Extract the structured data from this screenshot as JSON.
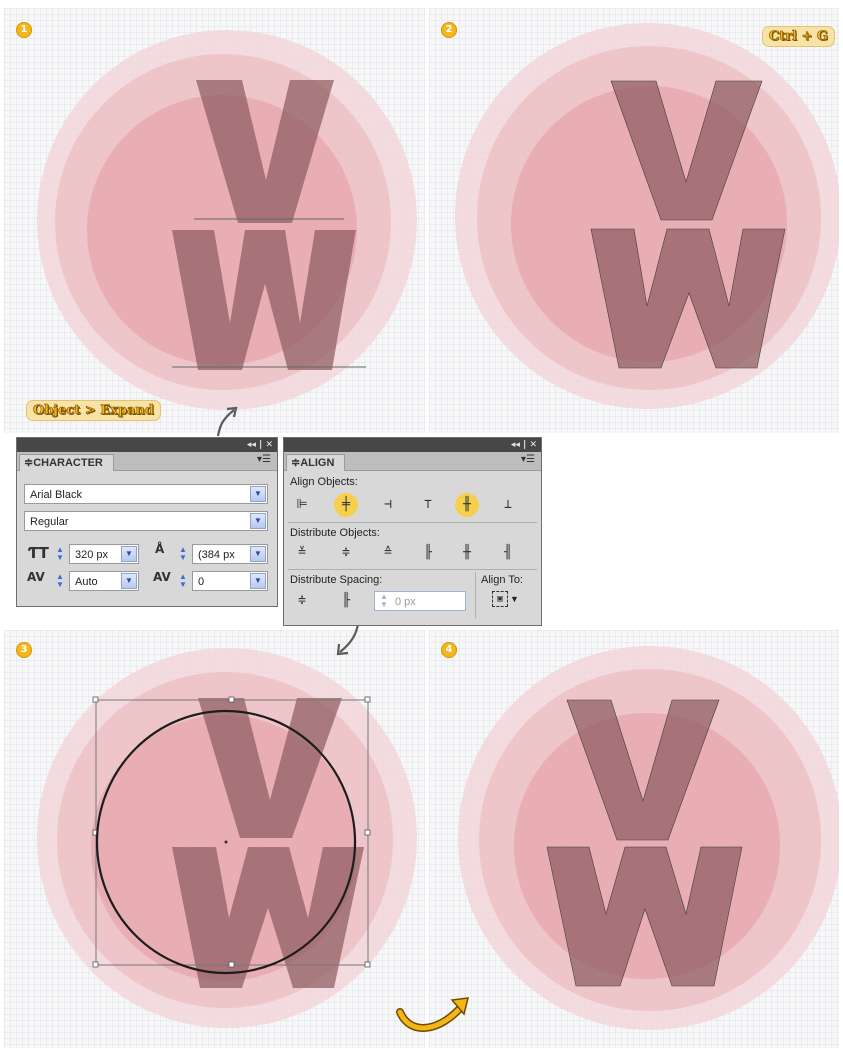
{
  "steps": {
    "s1": "1",
    "s2": "2",
    "s3": "3",
    "s4": "4"
  },
  "tags": {
    "shortcut": "Ctrl + G",
    "menu": "Object > Expand"
  },
  "artwork": {
    "letters": [
      "V",
      "W"
    ]
  },
  "character_panel": {
    "title_icons": "◂◂ | ✕",
    "tab": "≑CHARACTER",
    "menu_icon": "▾☰",
    "font_family": "Arial Black",
    "font_style": "Regular",
    "font_size": "320 px",
    "leading": "(384 px",
    "kerning": "Auto",
    "tracking": "0"
  },
  "align_panel": {
    "title_icons": "◂◂ | ✕",
    "tab": "≑ALIGN",
    "menu_icon": "▾☰",
    "align_objects_label": "Align Objects:",
    "distribute_objects_label": "Distribute Objects:",
    "distribute_spacing_label": "Distribute Spacing:",
    "spacing_value": "0 px",
    "align_to_label": "Align To:",
    "highlighted": [
      "horizontal-align-center",
      "vertical-align-center"
    ]
  },
  "colors": {
    "ring_outer": "#f0cfd3",
    "ring_mid": "#ebbcc2",
    "ring_inner": "#e7a9b0",
    "letter_fill": "#8e5d61",
    "highlight": "#f6cf4f"
  }
}
